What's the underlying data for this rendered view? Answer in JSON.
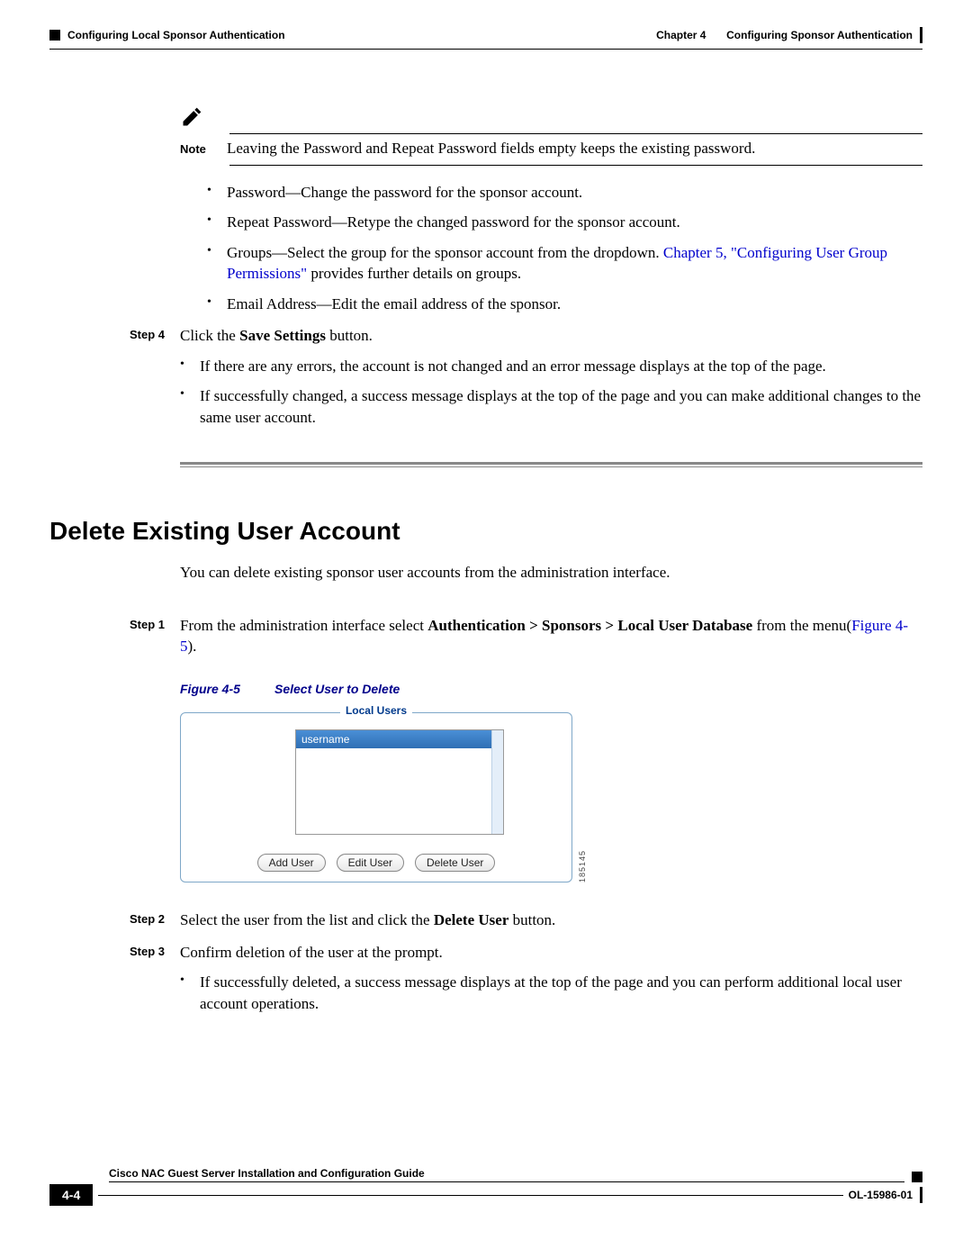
{
  "header": {
    "left": "Configuring Local Sponsor Authentication",
    "right_chapter": "Chapter 4",
    "right_title": "Configuring Sponsor Authentication"
  },
  "note": {
    "label": "Note",
    "text": "Leaving the Password and Repeat Password fields empty keeps the existing password."
  },
  "top_bullets": {
    "b1": "Password—Change the password for the sponsor account.",
    "b2": "Repeat Password—Retype the changed password for the sponsor account.",
    "b3_pre": "Groups—Select the group for the sponsor account from the dropdown. ",
    "b3_link": "Chapter 5, \"Configuring User Group Permissions\"",
    "b3_post": " provides further details on groups.",
    "b4": "Email Address—Edit the email address of the sponsor."
  },
  "step4": {
    "label": "Step 4",
    "pre": "Click the ",
    "bold": "Save Settings",
    "post": " button.",
    "sub1": "If there are any errors, the account is not changed and an error message displays at the top of the page.",
    "sub2": "If successfully changed, a success message displays at the top of the page and you can make additional changes to the same user account."
  },
  "section2": {
    "heading": "Delete Existing User Account",
    "intro": "You can delete existing sponsor user accounts from the administration interface."
  },
  "s2step1": {
    "label": "Step 1",
    "pre": "From the administration interface select ",
    "bold": "Authentication > Sponsors > Local User Database",
    "mid": " from the menu(",
    "link": "Figure 4-5",
    "post": ")."
  },
  "figure": {
    "no": "Figure 4-5",
    "title": "Select User to Delete",
    "legend": "Local Users",
    "selected": "username",
    "btn_add": "Add User",
    "btn_edit": "Edit User",
    "btn_delete": "Delete User",
    "sidecode": "185145"
  },
  "s2step2": {
    "label": "Step 2",
    "pre": "Select the user from the list and click the ",
    "bold": "Delete User",
    "post": " button."
  },
  "s2step3": {
    "label": "Step 3",
    "text": "Confirm deletion of the user at the prompt.",
    "sub1": "If successfully deleted, a success message displays at the top of the page and you can perform additional local user account operations."
  },
  "footer": {
    "guide": "Cisco NAC Guest Server Installation and Configuration Guide",
    "page": "4-4",
    "doc": "OL-15986-01"
  }
}
